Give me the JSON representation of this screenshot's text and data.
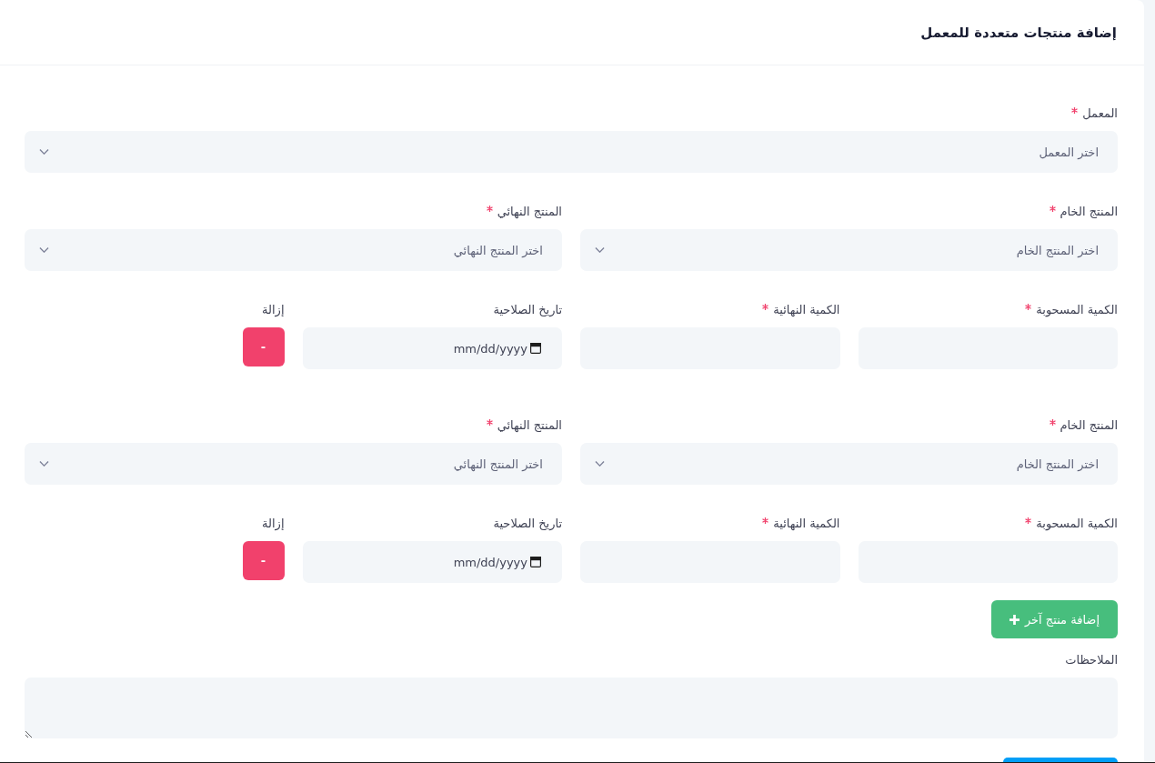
{
  "page_header": {
    "title": "إضافة منتجات متعددة للمعمل"
  },
  "lab": {
    "label": "المعمل",
    "required": true,
    "placeholder": "اختر المعمل"
  },
  "products": [
    {
      "raw_product": {
        "label": "المنتج الخام",
        "required": true,
        "placeholder": "اختر المنتج الخام"
      },
      "final_product": {
        "label": "المنتج النهائي",
        "required": true,
        "placeholder": "اختر المنتج النهائي"
      },
      "withdrawn_quantity": {
        "label": "الكمية المسحوبة",
        "required": true
      },
      "final_quantity": {
        "label": "الكمية النهائية",
        "required": true
      },
      "expiry_date": {
        "label": "تاريخ الصلاحية",
        "placeholder": "mm/dd/yyyy"
      },
      "remove": {
        "label": "إزالة",
        "button": "-"
      }
    },
    {
      "raw_product": {
        "label": "المنتج الخام",
        "required": true,
        "placeholder": "اختر المنتج الخام"
      },
      "final_product": {
        "label": "المنتج النهائي",
        "required": true,
        "placeholder": "اختر المنتج النهائي"
      },
      "withdrawn_quantity": {
        "label": "الكمية المسحوبة",
        "required": true
      },
      "final_quantity": {
        "label": "الكمية النهائية",
        "required": true
      },
      "expiry_date": {
        "label": "تاريخ الصلاحية",
        "placeholder": "mm/dd/yyyy"
      },
      "remove": {
        "label": "إزالة",
        "button": "-"
      }
    }
  ],
  "add_product_button": "إضافة منتج آخر",
  "notes": {
    "label": "الملاحظات"
  }
}
